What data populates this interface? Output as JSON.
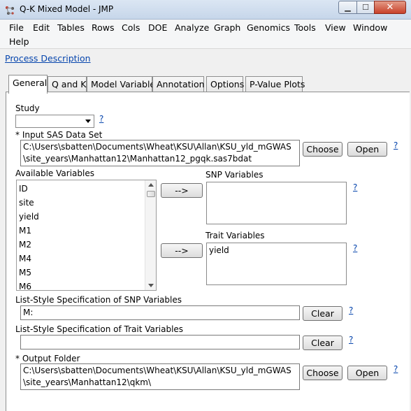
{
  "window": {
    "title": "Q-K Mixed Model - JMP"
  },
  "menu": [
    "File",
    "Edit",
    "Tables",
    "Rows",
    "Cols",
    "DOE",
    "Analyze",
    "Graph",
    "Genomics",
    "Tools",
    "View",
    "Window",
    "Help"
  ],
  "process_link": "Process Description",
  "tabs": [
    "General",
    "Q and K",
    "Model Variables",
    "Annotation",
    "Options",
    "P-Value Plots"
  ],
  "active_tab": "General",
  "study": {
    "label": "Study",
    "value": ""
  },
  "help_mark": "?",
  "input_data": {
    "label": "* Input SAS Data Set",
    "value": "C:\\Users\\sbatten\\Documents\\Wheat\\KSU\\Allan\\KSU_yld_mGWAS\\site_years\\Manhattan12\\Manhattan12_pgqk.sas7bdat"
  },
  "choose_label": "Choose",
  "open_label": "Open",
  "arrow_label": "-->",
  "clear_label": "Clear",
  "available_variables": {
    "label": "Available Variables",
    "items": [
      "ID",
      "site",
      "yield",
      "M1",
      "M2",
      "M4",
      "M5",
      "M6"
    ]
  },
  "snp_variables": {
    "label": "SNP Variables",
    "items": []
  },
  "trait_variables": {
    "label": "Trait Variables",
    "items": [
      "yield"
    ]
  },
  "list_snp": {
    "label": "List-Style Specification of SNP Variables",
    "value": "M:"
  },
  "list_trait": {
    "label": "List-Style Specification of Trait Variables",
    "value": ""
  },
  "output_folder": {
    "label": "* Output Folder",
    "value": "C:\\Users\\sbatten\\Documents\\Wheat\\KSU\\Allan\\KSU_yld_mGWAS\\site_years\\Manhattan12\\qkm\\"
  }
}
